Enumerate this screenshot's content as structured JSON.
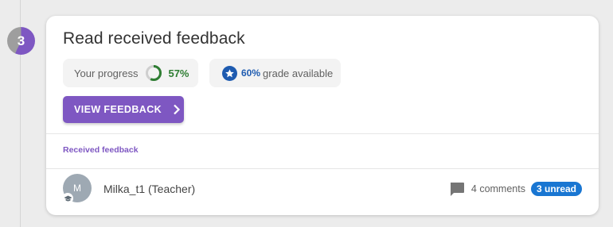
{
  "step": {
    "number": "3",
    "progress_percent": 57,
    "colors": {
      "done": "#7e57c2",
      "remaining": "#9e9e9e"
    }
  },
  "card": {
    "title": "Read received feedback",
    "progress": {
      "label": "Your progress",
      "value_text": "57%",
      "value": 57
    },
    "grade": {
      "percent_text": "60%",
      "label": "grade available",
      "icon": "star-icon"
    },
    "view_button": {
      "label": "VIEW FEEDBACK",
      "icon": "chevron-right-icon"
    },
    "section_label": "Received feedback"
  },
  "feedback": [
    {
      "avatar_initial": "M",
      "name": "Milka_t1 (Teacher)",
      "badge_icon": "graduation-cap-icon",
      "comment_icon": "comment-icon",
      "comments": "4 comments",
      "unread": "3 unread"
    }
  ],
  "colors": {
    "accent": "#7e57c2",
    "progress_green": "#2e7d32",
    "grade_blue": "#1e5bb0",
    "unread_blue": "#1976d2"
  }
}
